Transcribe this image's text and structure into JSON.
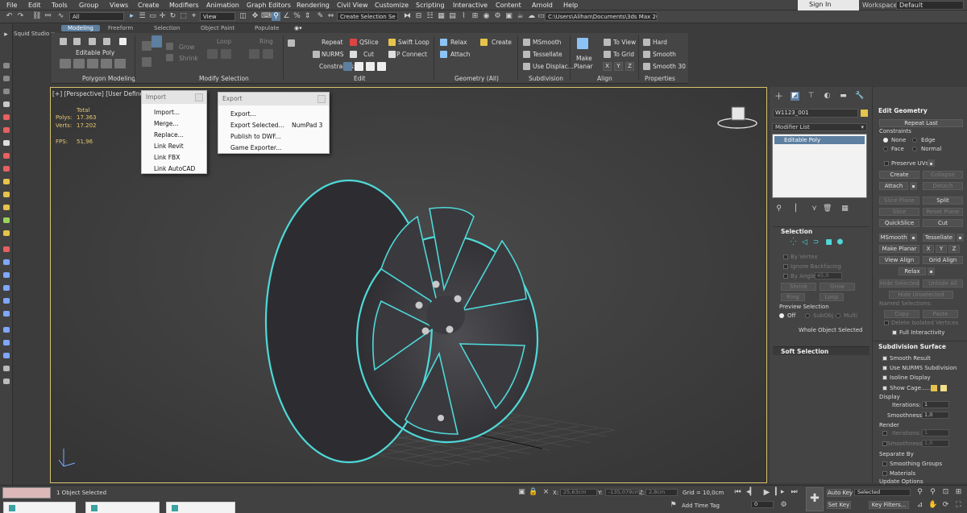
{
  "menubar": [
    "File",
    "Edit",
    "Tools",
    "Group",
    "Views",
    "Create",
    "Modifiers",
    "Animation",
    "Graph Editors",
    "Rendering",
    "Civil View",
    "Customize",
    "Scripting",
    "Interactive",
    "Content",
    "Arnold",
    "Help"
  ],
  "signin": "Sign In",
  "workspaces_label": "Workspaces:",
  "workspaces_value": "Default",
  "toolbar": {
    "filter": "All",
    "view": "View",
    "selection_set": "Create Selection Se",
    "path": "C:\\Users\\Alihan\\Documents\\3ds Max 2021"
  },
  "studio_label": "Squid Studio v",
  "ribbon_tabs": [
    "Modeling",
    "Freeform",
    "Selection",
    "Object Paint",
    "Populate"
  ],
  "ribbon": {
    "editable_poly": "Editable Poly",
    "polygon_modeling": "Polygon Modeling",
    "modify_selection": "Modify Selection",
    "loop": "Loop",
    "ring": "Ring",
    "grow": "Grow",
    "shrink": "Shrink",
    "repeat": "Repeat",
    "qslice": "QSlice",
    "swift_loop": "Swift Loop",
    "nurms": "NURMS",
    "cut": "Cut",
    "p_connect": "P Connect",
    "constraints": "Constraints:",
    "edit": "Edit",
    "relax": "Relax",
    "create": "Create",
    "attach": "Attach",
    "geometry_all": "Geometry (All)",
    "msmooth": "MSmooth",
    "tessellate": "Tessellate",
    "use_displace": "Use Displac...",
    "subdivision": "Subdivision",
    "make_planar_1": "Make",
    "make_planar_2": "Planar",
    "to_view": "To View",
    "to_grid": "To Grid",
    "x": "X",
    "y": "Y",
    "z": "Z",
    "align": "Align",
    "hard": "Hard",
    "smooth": "Smooth",
    "smooth30": "Smooth 30",
    "properties": "Properties"
  },
  "viewport": {
    "label": "[+] [Perspective] [User Defined] [",
    "total_label": "Total",
    "polys_label": "Polys:",
    "polys_value": "17.363",
    "verts_label": "Verts:",
    "verts_value": "17.202",
    "fps_label": "FPS:",
    "fps_value": "51,96"
  },
  "import_menu": {
    "title": "Import",
    "items": [
      "Import...",
      "Merge...",
      "Replace...",
      "Link Revit",
      "Link FBX",
      "Link AutoCAD"
    ]
  },
  "export_menu": {
    "title": "Export",
    "items": [
      "Export...",
      "Export Selected...",
      "Publish to DWF...",
      "Game Exporter..."
    ],
    "shortcut": "NumPad 3"
  },
  "cmd": {
    "object_name": "W1123_001",
    "modifier_list": "Modifier List",
    "stack_item": "Editable Poly",
    "selection": "Selection",
    "by_vertex": "By Vertex",
    "ignore_backfacing": "Ignore Backfacing",
    "by_angle": "By Angle:",
    "by_angle_val": "45,0",
    "shrink": "Shrink",
    "grow": "Grow",
    "ring": "Ring",
    "loop": "Loop",
    "preview_selection": "Preview Selection",
    "off": "Off",
    "subobj": "SubObj",
    "multi": "Multi",
    "whole_object_selected": "Whole Object Selected",
    "soft_selection": "Soft Selection",
    "edit_geometry": "Edit Geometry",
    "repeat_last": "Repeat Last",
    "constraints": "Constraints",
    "none": "None",
    "edge": "Edge",
    "face": "Face",
    "normal": "Normal",
    "preserve_uvs": "Preserve UVs",
    "create": "Create",
    "collapse": "Collapse",
    "attach": "Attach",
    "detach": "Detach",
    "slice_plane": "Slice Plane",
    "split": "Split",
    "slice": "Slice",
    "reset_plane": "Reset Plane",
    "quickslice": "QuickSlice",
    "cut": "Cut",
    "msmooth": "MSmooth",
    "tessellate": "Tessellate",
    "make_planar": "Make Planar",
    "x": "X",
    "y": "Y",
    "z": "Z",
    "view_align": "View Align",
    "grid_align": "Grid Align",
    "relax": "Relax",
    "hide_selected": "Hide Selected",
    "unhide_all": "Unhide All",
    "hide_unselected": "Hide Unselected",
    "named_selections": "Named Selections:",
    "copy": "Copy",
    "paste": "Paste",
    "delete_isolated": "Delete Isolated Vertices",
    "full_interactivity": "Full Interactivity",
    "subdivision_surface": "Subdivision Surface",
    "smooth_result": "Smooth Result",
    "use_nurms": "Use NURMS Subdivision",
    "isoline_display": "Isoline Display",
    "show_cage": "Show Cage......",
    "display": "Display",
    "iterations": "Iterations:",
    "iterations_val": "1",
    "smoothness": "Smoothness:",
    "smoothness_val": "1,0",
    "render": "Render",
    "separate_by": "Separate By",
    "smoothing_groups": "Smoothing Groups",
    "materials": "Materials",
    "update_options": "Update Options"
  },
  "status": {
    "selected": "1 Object Selected",
    "x_label": "X:",
    "x_val": "25,63cm",
    "y_label": "Y:",
    "y_val": "-135,079cm",
    "z_label": "Z:",
    "z_val": "2,8cm",
    "grid": "Grid = 10,0cm",
    "add_time_tag": "Add Time Tag",
    "auto_key": "Auto Key",
    "set_key": "Set Key",
    "selected_dd": "Selected",
    "key_filters": "Key Filters...",
    "frame": "0"
  },
  "colors": {
    "accent": "#5d7fa0",
    "cage": "#e8c83a",
    "outline": "#4fd8d8"
  }
}
